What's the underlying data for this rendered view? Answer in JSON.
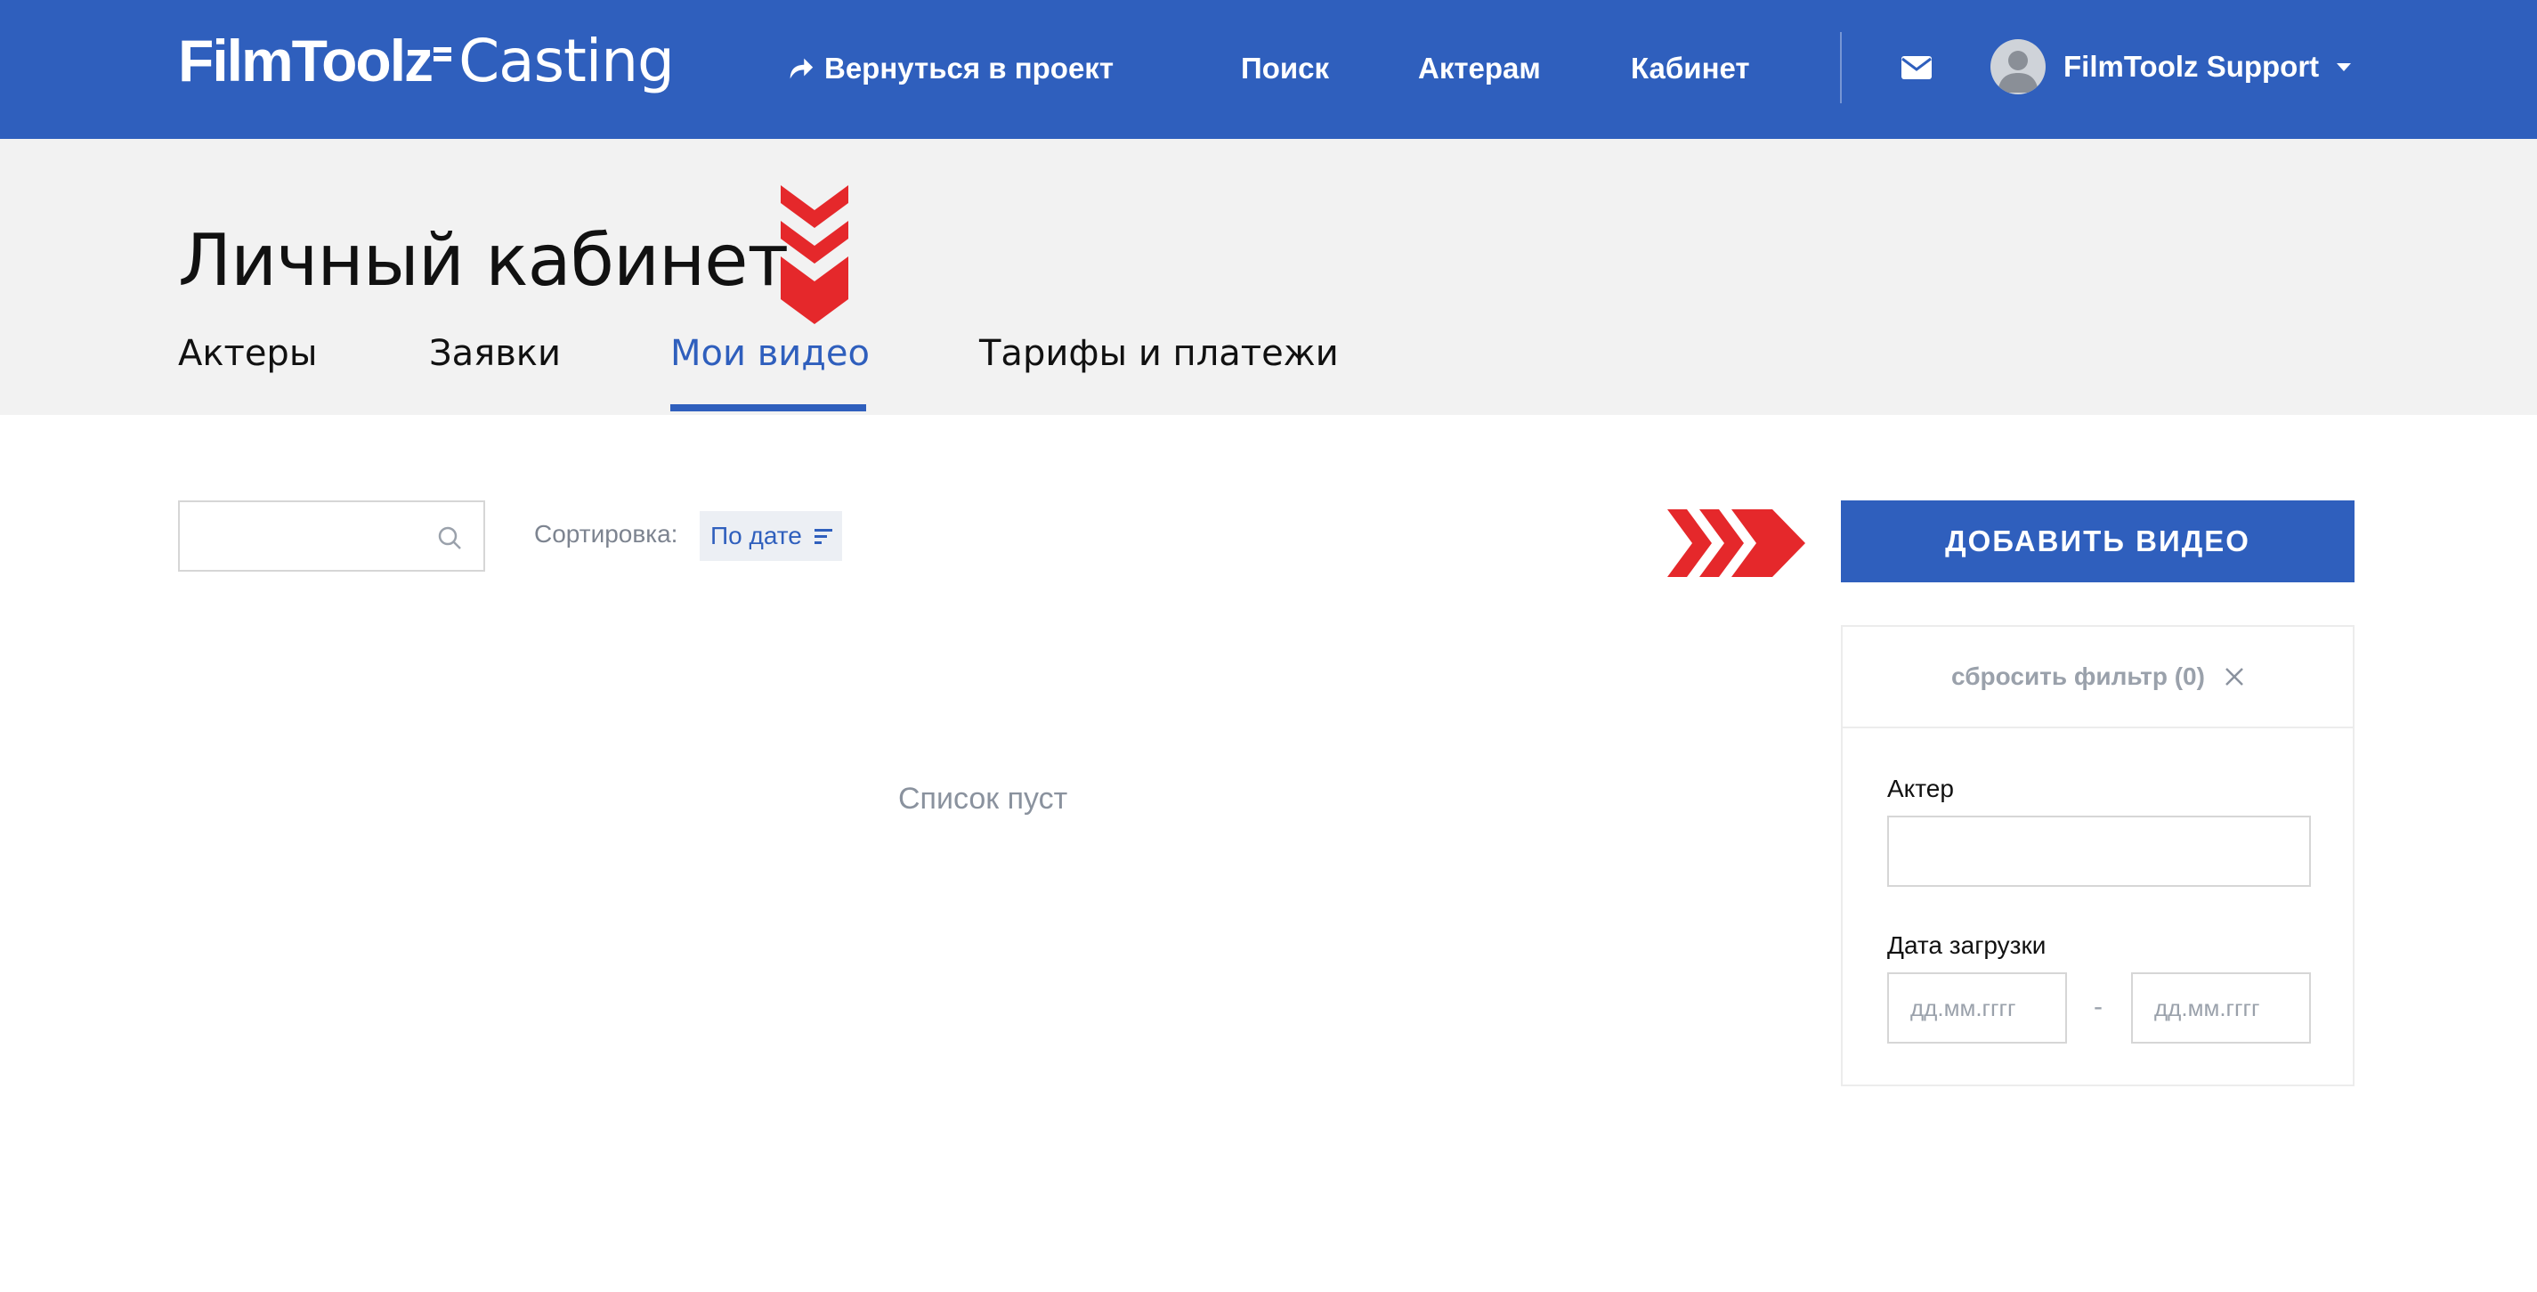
{
  "header": {
    "logo_bold": "FilmToolz",
    "logo_light": "Casting",
    "back_label": "Вернуться в проект",
    "nav": [
      "Поиск",
      "Актерам",
      "Кабинет"
    ],
    "user_name": "FilmToolz Support"
  },
  "colors": {
    "brand_blue": "#2f5fbd",
    "accent_red": "#e5282b",
    "subheader_bg": "#f2f2f2"
  },
  "page": {
    "title": "Личный кабинет",
    "tabs": [
      {
        "label": "Актеры",
        "active": false
      },
      {
        "label": "Заявки",
        "active": false
      },
      {
        "label": "Мои видео",
        "active": true
      },
      {
        "label": "Тарифы и платежи",
        "active": false
      }
    ]
  },
  "toolbar": {
    "search_value": "",
    "sort_label": "Сортировка:",
    "sort_value": "По дате",
    "add_button": "ДОБАВИТЬ ВИДЕО"
  },
  "content": {
    "empty_text": "Список пуст"
  },
  "filter": {
    "reset_label": "сбросить фильтр (0)",
    "actor_label": "Актер",
    "actor_value": "",
    "date_label": "Дата загрузки",
    "date_from_placeholder": "дд.мм.гггг",
    "date_separator": "-",
    "date_to_placeholder": "дд.мм.гггг"
  },
  "icons": [
    "reply-arrow-icon",
    "mail-icon",
    "avatar-icon",
    "caret-down-icon",
    "search-icon",
    "sort-icon",
    "close-icon",
    "chevrons-down-icon",
    "chevrons-right-icon"
  ]
}
